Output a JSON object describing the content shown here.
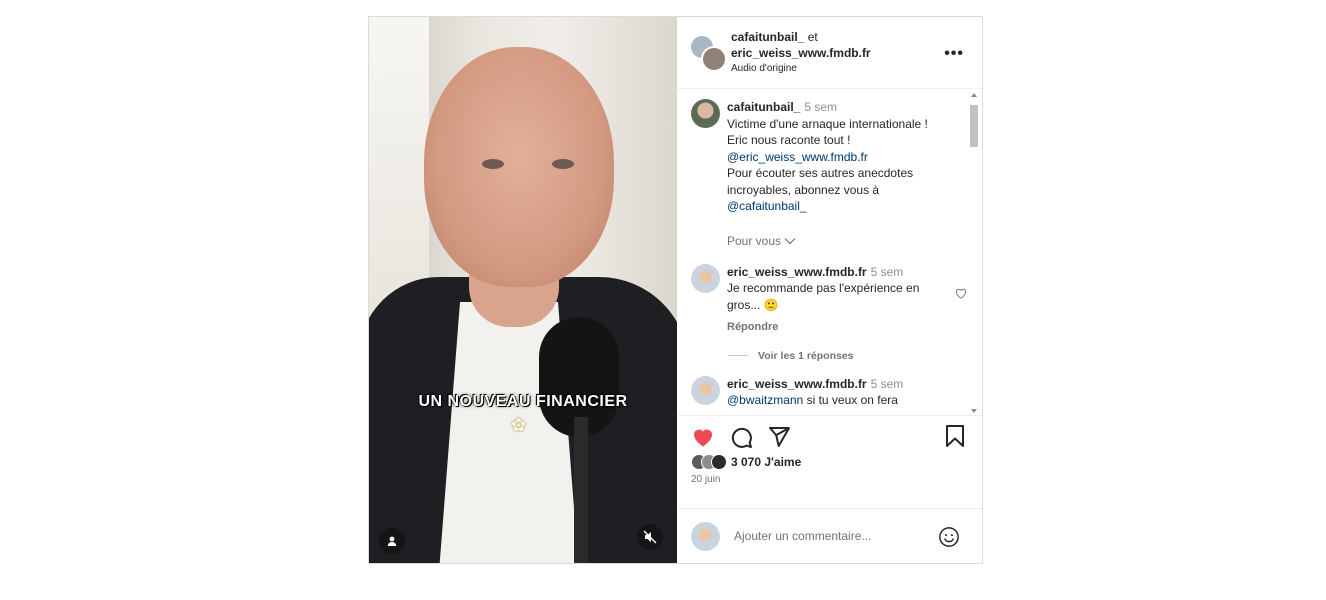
{
  "post": {
    "header": {
      "author1": "cafaitunbail_",
      "joiner": "et",
      "author2": "eric_weiss_www.fmdb.fr",
      "audio": "Audio d'origine",
      "more": "•••"
    },
    "video": {
      "caption": "UN NOUVEAU FINANCIER",
      "caption_emoji": "✿"
    },
    "caption_comment": {
      "user": "cafaitunbail_",
      "time": "5 sem",
      "lines": [
        "Victime d'une arnaque internationale !",
        "Eric nous raconte tout !"
      ],
      "mention": "@eric_weiss_www.fmdb.fr",
      "lines2": [
        "Pour écouter ses autres anecdotes",
        "incroyables, abonnez vous à"
      ],
      "mention2": "@cafaitunbail_"
    },
    "filter": "Pour vous",
    "comments": [
      {
        "user": "eric_weiss_www.fmdb.fr",
        "time": "5 sem",
        "text": "Je recommande pas l'expérience en gros... 🙂",
        "reply": "Répondre",
        "view_replies": "Voir les 1 réponses"
      },
      {
        "user": "eric_weiss_www.fmdb.fr",
        "time": "5 sem",
        "mention": "@bwaitzmann",
        "text": "si tu veux on fera"
      }
    ],
    "likes": "3 070 J'aime",
    "date": "20 juin",
    "add_comment_placeholder": "Ajouter un commentaire...",
    "colors": {
      "heart": "#ed4956",
      "link": "#00376b",
      "muted": "#737373"
    },
    "icons": [
      "heart-icon",
      "comment-icon",
      "share-icon",
      "bookmark-icon",
      "emoji-icon",
      "user-tag-icon",
      "mute-icon",
      "more-icon"
    ]
  }
}
